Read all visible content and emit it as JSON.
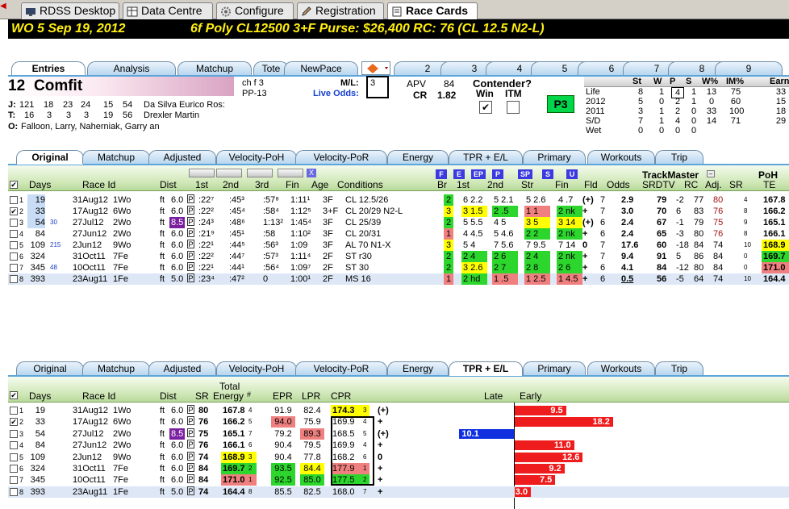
{
  "top_tabs": [
    {
      "label": "RDSS Desktop"
    },
    {
      "label": "Data Centre"
    },
    {
      "label": "Configure"
    },
    {
      "label": "Registration"
    },
    {
      "label": "Race Cards"
    }
  ],
  "race_header": {
    "left": "WO  5   Sep 19, 2012",
    "right": "6f  Poly  CL12500  3+F   Purse: $26,400   RC: 76  (CL 12.5 N2-L)"
  },
  "horse_tabs": [
    "Entries",
    "Analysis",
    "Matchup",
    "Tote",
    "NewPace"
  ],
  "post_tabs": [
    "2",
    "3",
    "4",
    "5",
    "6",
    "7",
    "8",
    "9"
  ],
  "horse": {
    "number": "12",
    "name": "Comfit",
    "sex": "ch f 3",
    "pp": "PP-13",
    "ml_label": "M/L:",
    "ml_value": "3",
    "live_odds_label": "Live Odds:",
    "apv_label": "APV",
    "apv": "84",
    "cr_label": "CR",
    "cr": "1.82",
    "contender": "Contender?",
    "win": "Win",
    "itm": "ITM",
    "p3": "P3",
    "j_label": "J:",
    "j_stats": [
      "121",
      "18",
      "23",
      "24",
      "15",
      "54"
    ],
    "j_name": "Da Silva Eurico Ros:",
    "t_label": "T:",
    "t_stats": [
      "16",
      "3",
      "3",
      "3",
      "19",
      "56"
    ],
    "t_name": "Drexler Martin",
    "o_label": "O:",
    "o_name": "Falloon, Larry, Naherniak, Garry an"
  },
  "stats": {
    "headers": [
      "St",
      "W",
      "P",
      "S",
      "W%",
      "IM%",
      "Earn"
    ],
    "rows": [
      [
        "Life",
        "8",
        "1",
        "4",
        "1",
        "13",
        "75",
        "33"
      ],
      [
        "2012",
        "5",
        "0",
        "2",
        "1",
        "0",
        "60",
        "15"
      ],
      [
        "2011",
        "3",
        "1",
        "2",
        "0",
        "33",
        "100",
        "18"
      ],
      [
        "S/D",
        "7",
        "1",
        "4",
        "0",
        "14",
        "71",
        "29"
      ],
      [
        "Wet",
        "0",
        "0",
        "0",
        "0",
        "",
        "",
        ""
      ]
    ]
  },
  "pp_tabs": [
    "Original",
    "Matchup",
    "Adjusted",
    "Velocity-PoH",
    "Velocity-PoR",
    "Energy",
    "TPR + E/L",
    "Primary",
    "Workouts",
    "Trip"
  ],
  "pp_header": {
    "days": "Days",
    "race_id": "Race Id",
    "dist": "Dist",
    "c1": "1st",
    "c2": "2nd",
    "c3": "3rd",
    "fin": "Fin",
    "age": "Age",
    "cond": "Conditions",
    "br": "Br",
    "s1": "1st",
    "s2": "2nd",
    "str": "Str",
    "sfin": "Fin",
    "fld": "Fld",
    "odds": "Odds",
    "trackmaster": "TrackMaster",
    "srdtv": "SRDTV",
    "rc": "RC",
    "adj": "Adj.",
    "sr": "SR",
    "poh": "PoH",
    "te": "TE",
    "btns": [
      "F",
      "E",
      "EP",
      "P",
      "SP",
      "S",
      "U"
    ],
    "x": "X"
  },
  "pp_rows": [
    {
      "n": "1",
      "days": "19",
      "date": "31Aug12",
      "rid": "1Wo",
      "surf": "ft",
      "dist": "6.0",
      "c1": ":22⁷",
      "c2": ":45³",
      "c3": ":57⁸",
      "fin": "1:11¹",
      "age": "3F",
      "cond": "CL 12.5/26",
      "br": "2",
      "s1": "6 2.2",
      "s2": "5 2.1",
      "str": "5 2.6",
      "sfin": "4 .7",
      "plus": "(+)",
      "fld": "7",
      "odds": "2.9",
      "srdtv": "79",
      "dtv": "-2",
      "rc": "77",
      "adj": "80",
      "sr": "4",
      "te": "167.8"
    },
    {
      "n": "2",
      "days": "33",
      "date": "17Aug12",
      "rid": "6Wo",
      "surf": "ft",
      "dist": "6.0",
      "c1": ":22²",
      "c2": ":45⁴",
      "c3": ":58⁴",
      "fin": "1:12⁵",
      "age": "3+F",
      "cond": "CL 20/29 N2-L",
      "br": "3",
      "s1": "3 1.5",
      "s2": "2 .5",
      "str": "1 1",
      "sfin": "2 nk",
      "plus": "+",
      "fld": "7",
      "odds": "3.0",
      "srdtv": "70",
      "dtv": "6",
      "rc": "83",
      "adj": "76",
      "sr": "8",
      "te": "166.2"
    },
    {
      "n": "3",
      "days": "54",
      "pre": "30",
      "date": "27Jul12",
      "rid": "2Wo",
      "surf": "ft",
      "dist": "8.5",
      "c1": ":24³",
      "c2": ":48⁶",
      "c3": "1:13²",
      "fin": "1:45⁴",
      "age": "3F",
      "cond": "CL 25/39",
      "br": "2",
      "s1": "5 5.5",
      "s2": "4 5",
      "str": "3 5",
      "sfin": "3 14",
      "plus": "(+)",
      "fld": "6",
      "odds": "2.4",
      "srdtv": "67",
      "dtv": "-1",
      "rc": "79",
      "adj": "75",
      "sr": "9",
      "te": "165.1"
    },
    {
      "n": "4",
      "days": "84",
      "date": "27Jun12",
      "rid": "2Wo",
      "surf": "ft",
      "dist": "6.0",
      "c1": ":21⁹",
      "c2": ":45¹",
      "c3": ":58",
      "fin": "1:10²",
      "age": "3F",
      "cond": "CL 20/31",
      "br": "1",
      "s1": "4 4.5",
      "s2": "5 4.6",
      "str": "2 2",
      "sfin": "2 nk",
      "plus": "+",
      "fld": "6",
      "odds": "2.4",
      "srdtv": "65",
      "dtv": "-3",
      "rc": "80",
      "adj": "76",
      "sr": "8",
      "te": "166.1"
    },
    {
      "n": "5",
      "days": "109",
      "pre": "215",
      "date": "2Jun12",
      "rid": "9Wo",
      "surf": "ft",
      "dist": "6.0",
      "c1": ":22¹",
      "c2": ":44⁵",
      "c3": ":56³",
      "fin": "1:09",
      "age": "3F",
      "cond": "AL 70 N1-X",
      "br": "3",
      "s1": "5 4",
      "s2": "7 5.6",
      "str": "7 9.5",
      "sfin": "7 14",
      "plus": "0",
      "fld": "7",
      "odds": "17.6",
      "srdtv": "60",
      "dtv": "-18",
      "rc": "84",
      "adj": "74",
      "sr": "10",
      "te": "168.9"
    },
    {
      "n": "6",
      "days": "324",
      "date": "31Oct11",
      "rid": "7Fe",
      "surf": "ft",
      "dist": "6.0",
      "c1": ":22²",
      "c2": ":44⁷",
      "c3": ":57³",
      "fin": "1:11⁴",
      "age": "2F",
      "cond": "ST r30",
      "br": "2",
      "s1": "2 4",
      "s2": "2 6",
      "str": "2 4",
      "sfin": "2 nk",
      "plus": "+",
      "fld": "7",
      "odds": "9.4",
      "srdtv": "91",
      "dtv": "5",
      "rc": "86",
      "adj": "84",
      "sr": "0",
      "te": "169.7"
    },
    {
      "n": "7",
      "days": "345",
      "pre": "48",
      "date": "10Oct11",
      "rid": "7Fe",
      "surf": "ft",
      "dist": "6.0",
      "c1": ":22¹",
      "c2": ":44¹",
      "c3": ":56⁴",
      "fin": "1:09⁷",
      "age": "2F",
      "cond": "ST 30",
      "br": "2",
      "s1": "3 2.6",
      "s2": "2 7",
      "str": "2 8",
      "sfin": "2 6",
      "plus": "+",
      "fld": "6",
      "odds": "4.1",
      "srdtv": "84",
      "dtv": "-12",
      "rc": "80",
      "adj": "84",
      "sr": "0",
      "te": "171.0"
    },
    {
      "n": "8",
      "days": "393",
      "date": "23Aug11",
      "rid": "1Fe",
      "surf": "ft",
      "dist": "5.0",
      "c1": ":23⁴",
      "c2": ":47²",
      "c3": "0",
      "fin": "1:00¹",
      "age": "2F",
      "cond": "MS 16",
      "br": "1",
      "s1": "2 hd",
      "s2": "1 .5",
      "str": "1 2.5",
      "sfin": "1 4.5",
      "plus": "+",
      "fld": "6",
      "odds": "0.5",
      "srdtv": "56",
      "dtv": "-5",
      "rc": "64",
      "adj": "74",
      "sr": "10",
      "te": "164.4"
    }
  ],
  "tpr_header": {
    "days": "Days",
    "race_id": "Race Id",
    "dist": "Dist",
    "sr": "SR",
    "total1": "Total",
    "total2": "Energy",
    "hash": "#",
    "epr": "EPR",
    "lpr": "LPR",
    "cpr": "CPR",
    "late": "Late",
    "early": "Early"
  },
  "tpr_rows": [
    {
      "n": "1",
      "days": "19",
      "date": "31Aug12",
      "rid": "1Wo",
      "surf": "ft",
      "dist": "6.0",
      "sr": "80",
      "te": "167.8",
      "ten": "4",
      "epr": "91.9",
      "lpr": "82.4",
      "cpr": "174.3",
      "cn": "3",
      "plus": "(+)",
      "early": 9.5
    },
    {
      "n": "2",
      "days": "33",
      "date": "17Aug12",
      "rid": "6Wo",
      "surf": "ft",
      "dist": "6.0",
      "sr": "76",
      "te": "166.2",
      "ten": "5",
      "epr": "94.0",
      "lpr": "75.9",
      "cpr": "169.9",
      "cn": "4",
      "plus": "+",
      "early": 18.2
    },
    {
      "n": "3",
      "days": "54",
      "date": "27Jul12",
      "rid": "2Wo",
      "surf": "ft",
      "dist": "8.5",
      "sr": "75",
      "te": "165.1",
      "ten": "7",
      "epr": "79.2",
      "lpr": "89.3",
      "cpr": "168.5",
      "cn": "5",
      "plus": "(+)",
      "late": 10.1
    },
    {
      "n": "4",
      "days": "84",
      "date": "27Jun12",
      "rid": "2Wo",
      "surf": "ft",
      "dist": "6.0",
      "sr": "76",
      "te": "166.1",
      "ten": "6",
      "epr": "90.4",
      "lpr": "79.5",
      "cpr": "169.9",
      "cn": "4",
      "plus": "+",
      "early": 11.0
    },
    {
      "n": "5",
      "days": "109",
      "date": "2Jun12",
      "rid": "9Wo",
      "surf": "ft",
      "dist": "6.0",
      "sr": "74",
      "te": "168.9",
      "ten": "3",
      "epr": "90.4",
      "lpr": "77.8",
      "cpr": "168.2",
      "cn": "6",
      "plus": "0",
      "early": 12.6
    },
    {
      "n": "6",
      "days": "324",
      "date": "31Oct11",
      "rid": "7Fe",
      "surf": "ft",
      "dist": "6.0",
      "sr": "84",
      "te": "169.7",
      "ten": "2",
      "epr": "93.5",
      "lpr": "84.4",
      "cpr": "177.9",
      "cn": "1",
      "plus": "+",
      "early": 9.2
    },
    {
      "n": "7",
      "days": "345",
      "date": "10Oct11",
      "rid": "7Fe",
      "surf": "ft",
      "dist": "6.0",
      "sr": "84",
      "te": "171.0",
      "ten": "1",
      "epr": "92.5",
      "lpr": "85.0",
      "cpr": "177.5",
      "cn": "2",
      "plus": "+",
      "early": 7.5
    },
    {
      "n": "8",
      "days": "393",
      "date": "23Aug11",
      "rid": "1Fe",
      "surf": "ft",
      "dist": "5.0",
      "sr": "74",
      "te": "164.4",
      "ten": "8",
      "epr": "85.5",
      "lpr": "82.5",
      "cpr": "168.0",
      "cn": "7",
      "plus": "+",
      "early": 3.0
    }
  ]
}
